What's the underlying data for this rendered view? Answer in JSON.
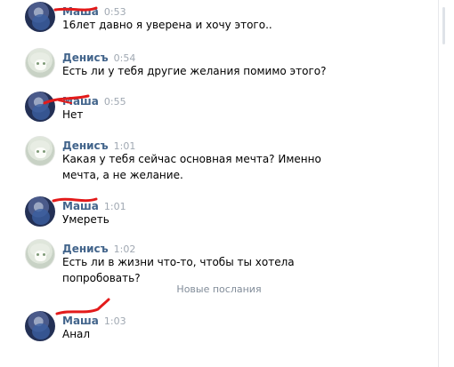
{
  "messages": [
    {
      "author": "Маша",
      "time": "0:53",
      "text": "16лет давно я уверена и хочу этого..",
      "avatar": "masha-avatar"
    },
    {
      "author": "Денисъ",
      "time": "0:54",
      "text": "Есть ли у тебя другие желания помимо этого?",
      "avatar": "denis-avatar"
    },
    {
      "author": "Маша",
      "time": "0:55",
      "text": "Нет",
      "avatar": "masha-avatar"
    },
    {
      "author": "Денисъ",
      "time": "1:01",
      "text": "Какая у тебя сейчас основная мечта? Именно мечта, а не желание.",
      "avatar": "denis-avatar"
    },
    {
      "author": "Маша",
      "time": "1:01",
      "text": "Умереть",
      "avatar": "masha-avatar"
    },
    {
      "author": "Денисъ",
      "time": "1:02",
      "text": "Есть ли в жизни что-то, чтобы ты хотела попробовать?",
      "avatar": "denis-avatar"
    },
    {
      "author": "Маша",
      "time": "1:03",
      "text": "Анал",
      "avatar": "masha-avatar"
    }
  ],
  "divider": "Новые послания",
  "colors": {
    "author": "#42648b",
    "time": "#a0a8b2",
    "redaction": "#e31b1b",
    "divider": "#818c99"
  }
}
